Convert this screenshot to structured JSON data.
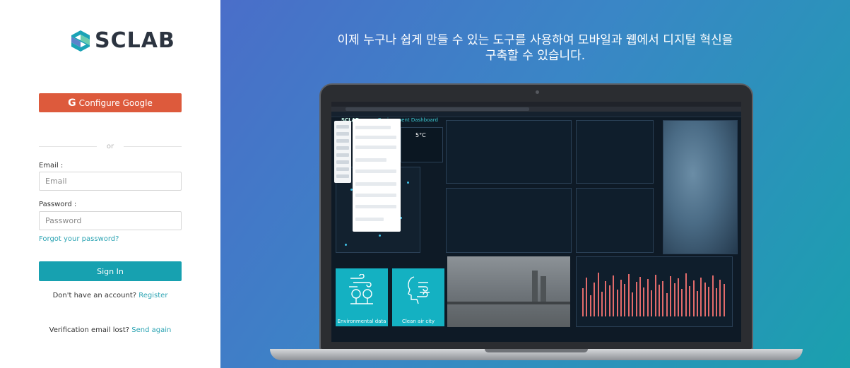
{
  "login": {
    "logo_text": "SCLAB",
    "google_button": "Configure Google",
    "google_icon": "G",
    "or_text": "or",
    "email_label": "Email :",
    "email_placeholder": "Email",
    "email_value": "",
    "password_label": "Password :",
    "password_placeholder": "Password",
    "password_value": "",
    "forgot_link": "Forgot your password?",
    "sign_in_button": "Sign In",
    "register_prompt": "Don't have an account?",
    "register_link": "Register",
    "verify_prompt": "Verification email lost?",
    "verify_link": "Send again"
  },
  "promo": {
    "headline_line1": "이제 누구나 쉽게 만들 수 있는 도구를 사용하여 모바일과 웹에서 디지털 혁신을",
    "headline_line2": "구축할 수 있습니다."
  },
  "dashboard_preview": {
    "title": "Environment Dashboard",
    "app_logo": "SCLAB",
    "weather_temp": "5°C",
    "tile_env": "Environmental data",
    "tile_clean": "Clean air city"
  },
  "colors": {
    "google": "#dd5a3c",
    "primary": "#17a1b0",
    "link": "#2da4b3"
  }
}
